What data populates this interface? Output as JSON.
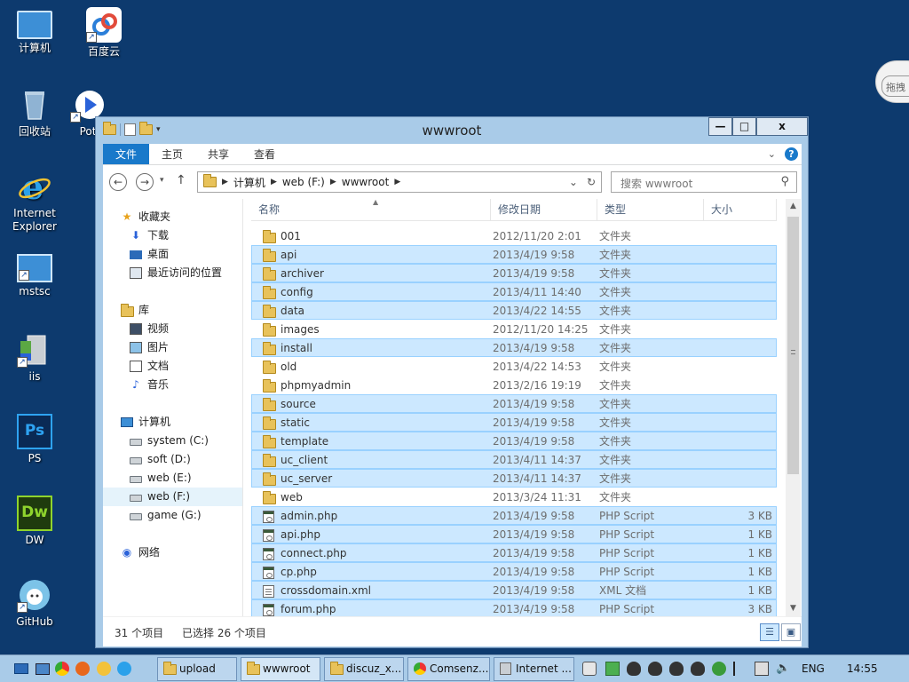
{
  "desktop": {
    "icons": [
      {
        "label": "计算机"
      },
      {
        "label": "百度云"
      },
      {
        "label": "回收站"
      },
      {
        "label": "Pot"
      },
      {
        "label": "Internet Explorer"
      },
      {
        "label": "mstsc"
      },
      {
        "label": "iis"
      },
      {
        "label": "PS"
      },
      {
        "label": "DW"
      },
      {
        "label": "GitHub"
      }
    ],
    "cloud_widget_label": "拖拽"
  },
  "window": {
    "title": "wwwroot",
    "buttons": {
      "minimize": "—",
      "maximize": "□",
      "close": "x"
    },
    "ribbon_tabs": [
      "文件",
      "主页",
      "共享",
      "查看"
    ],
    "address": {
      "crumbs": [
        "计算机",
        "web (F:)",
        "wwwroot"
      ]
    },
    "search_placeholder": "搜索 wwwroot",
    "nav_pane": {
      "favorites": {
        "label": "收藏夹",
        "items": [
          "下载",
          "桌面",
          "最近访问的位置"
        ]
      },
      "libraries": {
        "label": "库",
        "items": [
          "视频",
          "图片",
          "文档",
          "音乐"
        ]
      },
      "computer": {
        "label": "计算机",
        "items": [
          "system (C:)",
          "soft (D:)",
          "web (E:)",
          "web (F:)",
          "game (G:)"
        ],
        "selected": "web (F:)"
      },
      "network": {
        "label": "网络"
      }
    },
    "columns": {
      "name": "名称",
      "date": "修改日期",
      "type": "类型",
      "size": "大小"
    },
    "files": [
      {
        "name": "001",
        "date": "2012/11/20 2:01",
        "type": "文件夹",
        "size": "",
        "kind": "folder",
        "selected": false
      },
      {
        "name": "api",
        "date": "2013/4/19 9:58",
        "type": "文件夹",
        "size": "",
        "kind": "folder",
        "selected": true
      },
      {
        "name": "archiver",
        "date": "2013/4/19 9:58",
        "type": "文件夹",
        "size": "",
        "kind": "folder",
        "selected": true
      },
      {
        "name": "config",
        "date": "2013/4/11 14:40",
        "type": "文件夹",
        "size": "",
        "kind": "folder",
        "selected": true
      },
      {
        "name": "data",
        "date": "2013/4/22 14:55",
        "type": "文件夹",
        "size": "",
        "kind": "folder",
        "selected": true
      },
      {
        "name": "images",
        "date": "2012/11/20 14:25",
        "type": "文件夹",
        "size": "",
        "kind": "folder",
        "selected": false
      },
      {
        "name": "install",
        "date": "2013/4/19 9:58",
        "type": "文件夹",
        "size": "",
        "kind": "folder",
        "selected": true
      },
      {
        "name": "old",
        "date": "2013/4/22 14:53",
        "type": "文件夹",
        "size": "",
        "kind": "folder",
        "selected": false
      },
      {
        "name": "phpmyadmin",
        "date": "2013/2/16 19:19",
        "type": "文件夹",
        "size": "",
        "kind": "folder",
        "selected": false
      },
      {
        "name": "source",
        "date": "2013/4/19 9:58",
        "type": "文件夹",
        "size": "",
        "kind": "folder",
        "selected": true
      },
      {
        "name": "static",
        "date": "2013/4/19 9:58",
        "type": "文件夹",
        "size": "",
        "kind": "folder",
        "selected": true
      },
      {
        "name": "template",
        "date": "2013/4/19 9:58",
        "type": "文件夹",
        "size": "",
        "kind": "folder",
        "selected": true
      },
      {
        "name": "uc_client",
        "date": "2013/4/11 14:37",
        "type": "文件夹",
        "size": "",
        "kind": "folder",
        "selected": true
      },
      {
        "name": "uc_server",
        "date": "2013/4/11 14:37",
        "type": "文件夹",
        "size": "",
        "kind": "folder",
        "selected": true
      },
      {
        "name": "web",
        "date": "2013/3/24 11:31",
        "type": "文件夹",
        "size": "",
        "kind": "folder",
        "selected": false
      },
      {
        "name": "admin.php",
        "date": "2013/4/19 9:58",
        "type": "PHP Script",
        "size": "3 KB",
        "kind": "php",
        "selected": true
      },
      {
        "name": "api.php",
        "date": "2013/4/19 9:58",
        "type": "PHP Script",
        "size": "1 KB",
        "kind": "php",
        "selected": true
      },
      {
        "name": "connect.php",
        "date": "2013/4/19 9:58",
        "type": "PHP Script",
        "size": "1 KB",
        "kind": "php",
        "selected": true
      },
      {
        "name": "cp.php",
        "date": "2013/4/19 9:58",
        "type": "PHP Script",
        "size": "1 KB",
        "kind": "php",
        "selected": true
      },
      {
        "name": "crossdomain.xml",
        "date": "2013/4/19 9:58",
        "type": "XML 文档",
        "size": "1 KB",
        "kind": "xml",
        "selected": true
      },
      {
        "name": "forum.php",
        "date": "2013/4/19 9:58",
        "type": "PHP Script",
        "size": "3 KB",
        "kind": "php",
        "selected": true
      }
    ],
    "status": {
      "count": "31 个项目",
      "selected": "已选择 26 个项目"
    }
  },
  "taskbar": {
    "buttons": [
      "upload",
      "wwwroot",
      "discuz_x...",
      "Comsenz...",
      "Internet ..."
    ],
    "language": "ENG",
    "clock": "14:55"
  },
  "colors": {
    "desktop_bg": "#0d3a6e",
    "window_frame": "#a9cbe8",
    "file_tab": "#1979ca",
    "selection_bg": "#cce8ff",
    "selection_border": "#99d1ff",
    "folder": "#e8c25a"
  }
}
